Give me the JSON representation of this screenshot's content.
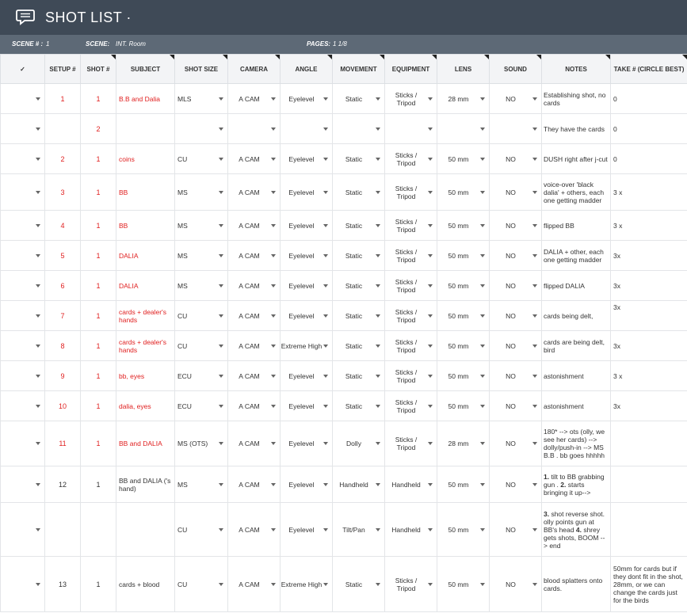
{
  "header": {
    "title": "SHOT LIST ·",
    "icon": "chat-bubble-icon"
  },
  "scene": {
    "scene_label": "SCENE # :",
    "scene_num": "1",
    "scene_name_label": "SCENE:",
    "scene_name": "INT. Room",
    "pages_label": "PAGES:",
    "pages": "1 1/8"
  },
  "columns": [
    "✓",
    "SETUP #",
    "SHOT #",
    "SUBJECT",
    "SHOT SIZE",
    "CAMERA",
    "ANGLE",
    "MOVEMENT",
    "EQUIPMENT",
    "LENS",
    "SOUND",
    "NOTES",
    "TAKE # (CIRCLE BEST)"
  ],
  "rows": [
    {
      "setup": "1",
      "shot": "1",
      "subject": "B.B and Dalia",
      "size": "MLS",
      "camera": "A CAM",
      "angle": "Eyelevel",
      "movement": "Static",
      "equipment": "Sticks / Tripod",
      "lens": "28 mm",
      "sound": "NO",
      "notes": "Establishing shot, no cards",
      "take": "0"
    },
    {
      "setup": "",
      "shot": "2",
      "subject": "",
      "size": "",
      "camera": "",
      "angle": "",
      "movement": "",
      "equipment": "",
      "lens": "",
      "sound": "",
      "notes": "They have the cards",
      "take": "0"
    },
    {
      "setup": "2",
      "shot": "1",
      "subject": "coins",
      "size": "CU",
      "camera": "A CAM",
      "angle": "Eyelevel",
      "movement": "Static",
      "equipment": "Sticks / Tripod",
      "lens": "50 mm",
      "sound": "NO",
      "notes": "DUSH right after j-cut",
      "take": "0"
    },
    {
      "setup": "3",
      "shot": "1",
      "subject": "BB",
      "size": "MS",
      "camera": "A CAM",
      "angle": "Eyelevel",
      "movement": "Static",
      "equipment": "Sticks / Tripod",
      "lens": "50 mm",
      "sound": "NO",
      "notes": "voice-over 'black dalia' + others, each one getting madder",
      "take": "3 x"
    },
    {
      "setup": "4",
      "shot": "1",
      "subject": "BB",
      "size": "MS",
      "camera": "A CAM",
      "angle": "Eyelevel",
      "movement": "Static",
      "equipment": "Sticks / Tripod",
      "lens": "50 mm",
      "sound": "NO",
      "notes": "flipped BB",
      "take": "3 x"
    },
    {
      "setup": "5",
      "shot": "1",
      "subject": "DALIA",
      "size": "MS",
      "camera": "A CAM",
      "angle": "Eyelevel",
      "movement": "Static",
      "equipment": "Sticks / Tripod",
      "lens": "50 mm",
      "sound": "NO",
      "notes": "DALIA + other, each one getting madder",
      "take": "3x"
    },
    {
      "setup": "6",
      "shot": "1",
      "subject": "DALIA",
      "size": "MS",
      "camera": "A CAM",
      "angle": "Eyelevel",
      "movement": "Static",
      "equipment": "Sticks / Tripod",
      "lens": "50 mm",
      "sound": "NO",
      "notes": "flipped DALIA",
      "take": "3x"
    },
    {
      "setup": "7",
      "shot": "1",
      "subject": "cards + dealer's hands",
      "size": "CU",
      "camera": "A CAM",
      "angle": "Eyelevel",
      "movement": "Static",
      "equipment": "Sticks / Tripod",
      "lens": "50 mm",
      "sound": "NO",
      "notes": "cards being delt,",
      "take": "3x"
    },
    {
      "setup": "8",
      "shot": "1",
      "subject": "cards + dealer's hands",
      "size": "CU",
      "camera": "A CAM",
      "angle": "Extreme High",
      "movement": "Static",
      "equipment": "Sticks / Tripod",
      "lens": "50 mm",
      "sound": "NO",
      "notes": "cards are being delt, bird",
      "take": "3x"
    },
    {
      "setup": "9",
      "shot": "1",
      "subject": "bb, eyes",
      "size": "ECU",
      "camera": "A CAM",
      "angle": "Eyelevel",
      "movement": "Static",
      "equipment": "Sticks / Tripod",
      "lens": "50 mm",
      "sound": "NO",
      "notes": "astonishment",
      "take": "3 x"
    },
    {
      "setup": "10",
      "shot": "1",
      "subject": "dalia, eyes",
      "size": "ECU",
      "camera": "A CAM",
      "angle": "Eyelevel",
      "movement": "Static",
      "equipment": "Sticks / Tripod",
      "lens": "50 mm",
      "sound": "NO",
      "notes": "astonishment",
      "take": "3x"
    },
    {
      "setup": "11",
      "shot": "1",
      "subject": "BB and DALIA",
      "size": "MS (OTS)",
      "camera": "A CAM",
      "angle": "Eyelevel",
      "movement": "Dolly",
      "equipment": "Sticks / Tripod",
      "lens": "28 mm",
      "sound": "NO",
      "notes": "180* --> ots (olly, we see her cards) --> dolly/push-in --> MS B.B . bb goes hhhhh",
      "take": ""
    },
    {
      "setup": "12",
      "shot": "1",
      "subject": "BB and DALIA ('s hand)",
      "size": "MS",
      "camera": "A CAM",
      "angle": "Eyelevel",
      "movement": "Handheld",
      "equipment": "Handheld",
      "lens": "50 mm",
      "sound": "NO",
      "notes_b1": "1.",
      "notes_a1": " tilt to BB grabbing gun . ",
      "notes_b2": "2.",
      "notes_a2": " starts bringing it up-->",
      "take": ""
    },
    {
      "setup": "",
      "shot": "",
      "subject": "",
      "size": "CU",
      "camera": "A CAM",
      "angle": "Eyelevel",
      "movement": "Tilt/Pan",
      "equipment": "Handheld",
      "lens": "50 mm",
      "sound": "NO",
      "notes_b1": "3.",
      "notes_a1": " shot reverse shot. olly points gun at BB's head ",
      "notes_b2": "4.",
      "notes_a2": " shrey gets shots, BOOM --> end",
      "take": ""
    },
    {
      "setup": "13",
      "shot": "1",
      "subject": "cards + blood",
      "size": "CU",
      "camera": "A CAM",
      "angle": "Extreme High",
      "movement": "Static",
      "equipment": "Sticks / Tripod",
      "lens": "50 mm",
      "sound": "NO",
      "notes": "blood splatters onto cards.",
      "take": "50mm for cards but if  they dont fit in the shot, 28mm, or we can change the cards just for the birds"
    }
  ]
}
